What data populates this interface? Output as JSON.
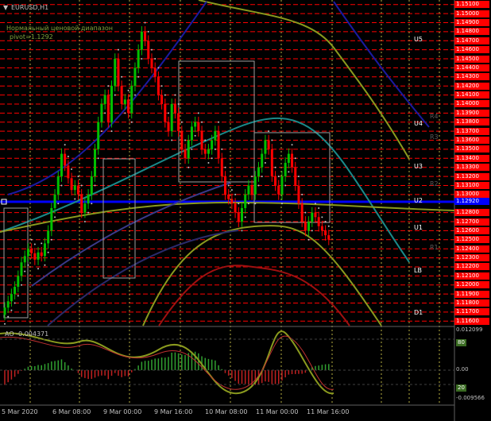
{
  "chart": {
    "symbol_label": "EURUSD,H1",
    "range_label": "Нормальный ценовой диапазон",
    "pivot_label": "pivot=1.1292",
    "indicator_label": "AO -0.004371",
    "current_price": "1.12920"
  },
  "price_axis": [
    "1.15100",
    "1.15000",
    "1.14900",
    "1.14800",
    "1.14700",
    "1.14600",
    "1.14500",
    "1.14400",
    "1.14300",
    "1.14200",
    "1.14100",
    "1.14000",
    "1.13900",
    "1.13800",
    "1.13700",
    "1.13600",
    "1.13500",
    "1.13400",
    "1.13300",
    "1.13200",
    "1.13100",
    "1.13000",
    "1.12800",
    "1.12700",
    "1.12600",
    "1.12500",
    "1.12400",
    "1.12300",
    "1.12200",
    "1.12100",
    "1.12000",
    "1.11900",
    "1.11800",
    "1.11700",
    "1.11600"
  ],
  "levels": [
    {
      "name": "U5",
      "faint": false
    },
    {
      "name": "U4",
      "faint": false
    },
    {
      "name": "U3",
      "faint": false
    },
    {
      "name": "U2",
      "faint": false
    },
    {
      "name": "U1",
      "faint": false
    },
    {
      "name": "LB",
      "faint": false
    },
    {
      "name": "D1",
      "faint": false
    }
  ],
  "faint_levels": [
    "R4",
    "R3",
    "R2",
    "R1"
  ],
  "osc_axis": {
    "top": "0.012099",
    "upper": "80",
    "zero": "0.00",
    "lower": "20",
    "bottom": "-0.009566"
  },
  "time_axis": [
    "5 Mar 2020",
    "6 Mar 08:00",
    "9 Mar 00:00",
    "9 Mar 16:00",
    "10 Mar 08:00",
    "11 Mar 00:00",
    "11 Mar 16:00"
  ],
  "colors": {
    "background": "#000000",
    "grid_red": "#ff0000",
    "bull_candle": "#00c000",
    "bear_candle": "#ff0000",
    "pivot_line": "#0000ff",
    "band_olive": "#8a9a1e",
    "band_teal": "#1a8a8a",
    "band_navy": "#1a1aa0",
    "band_darkred": "#a01010"
  },
  "chart_data": {
    "type": "candlestick",
    "symbol": "EURUSD",
    "timeframe": "H1",
    "pivot": 1.1292,
    "ylim": [
      1.1155,
      1.1515
    ],
    "closes": [
      1.1175,
      1.1182,
      1.119,
      1.1198,
      1.121,
      1.1225,
      1.1232,
      1.124,
      1.1235,
      1.1228,
      1.1236,
      1.1232,
      1.1246,
      1.126,
      1.1285,
      1.13,
      1.132,
      1.1345,
      1.1332,
      1.1318,
      1.1305,
      1.131,
      1.13,
      1.128,
      1.129,
      1.13,
      1.132,
      1.135,
      1.138,
      1.14,
      1.141,
      1.138,
      1.142,
      1.145,
      1.142,
      1.14,
      1.1405,
      1.139,
      1.142,
      1.144,
      1.146,
      1.148,
      1.147,
      1.145,
      1.144,
      1.143,
      1.141,
      1.14,
      1.138,
      1.137,
      1.14,
      1.139,
      1.137,
      1.135,
      1.134,
      1.136,
      1.1375,
      1.138,
      1.137,
      1.135,
      1.1345,
      1.135,
      1.136,
      1.137,
      1.134,
      1.132,
      1.13,
      1.1295,
      1.129,
      1.128,
      1.127,
      1.1285,
      1.13,
      1.131,
      1.13,
      1.132,
      1.133,
      1.1345,
      1.136,
      1.135,
      1.132,
      1.131,
      1.13,
      1.132,
      1.1335,
      1.1345,
      1.133,
      1.131,
      1.129,
      1.127,
      1.126,
      1.127,
      1.128,
      1.1275,
      1.1265,
      1.126,
      1.1255,
      1.125
    ]
  }
}
